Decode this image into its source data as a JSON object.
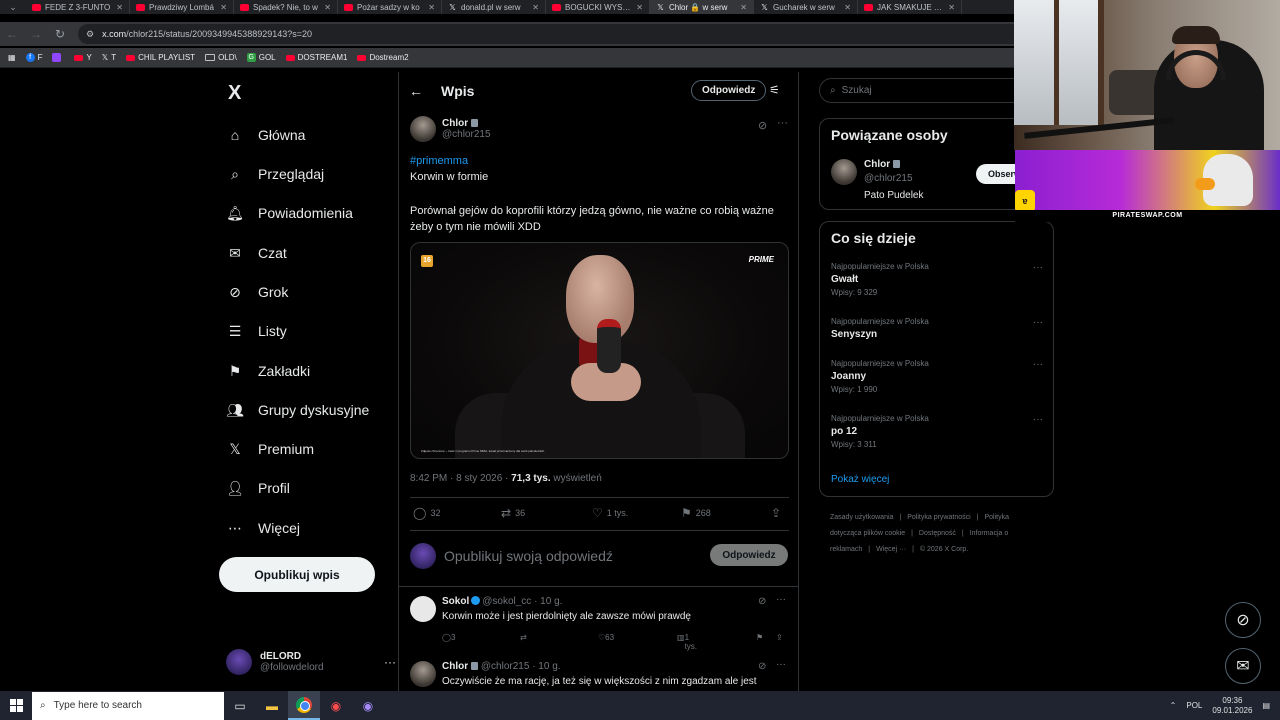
{
  "browser": {
    "tabs": [
      {
        "title": "FEDE Z 3-FUNTO",
        "type": "yt"
      },
      {
        "title": "Prawdziwy Lombá",
        "type": "yt"
      },
      {
        "title": "Spadek? Nie, to w",
        "type": "yt"
      },
      {
        "title": "Pożar sadzy w ko",
        "type": "yt"
      },
      {
        "title": "donald.pl w serw",
        "type": "x"
      },
      {
        "title": "BOGUCKI WYSZE",
        "type": "yt"
      },
      {
        "title": "Chlor 🔒 w serw",
        "type": "x",
        "active": true
      },
      {
        "title": "Gucharek w serw",
        "type": "x"
      },
      {
        "title": "JAK SMAKUJE PIZ",
        "type": "yt"
      }
    ],
    "url_domain": "x.com",
    "url_path": "/chlor215/status/2009349945388929143?s=20",
    "bookmarks": [
      {
        "label": "F",
        "type": "fb"
      },
      {
        "label": "",
        "type": "tw"
      },
      {
        "label": "Y",
        "type": "yt"
      },
      {
        "label": "T",
        "type": "x"
      },
      {
        "label": "CHIL PLAYLIST",
        "type": "yt"
      },
      {
        "label": "OLD\\",
        "type": "folder"
      },
      {
        "label": "GOL",
        "type": "g"
      },
      {
        "label": "DOSTREAM1",
        "type": "yt"
      },
      {
        "label": "Dostream2",
        "type": "yt"
      }
    ]
  },
  "nav": {
    "logo": "X",
    "items": [
      {
        "label": "Główna",
        "icon": "home-icon"
      },
      {
        "label": "Przeglądaj",
        "icon": "search-icon"
      },
      {
        "label": "Powiadomienia",
        "icon": "bell-icon"
      },
      {
        "label": "Czat",
        "icon": "mail-icon"
      },
      {
        "label": "Grok",
        "icon": "grok-icon"
      },
      {
        "label": "Listy",
        "icon": "list-icon"
      },
      {
        "label": "Zakładki",
        "icon": "bookmark-icon"
      },
      {
        "label": "Grupy dyskusyjne",
        "icon": "people-icon"
      },
      {
        "label": "Premium",
        "icon": "x-icon"
      },
      {
        "label": "Profil",
        "icon": "person-icon"
      },
      {
        "label": "Więcej",
        "icon": "more-circle-icon"
      }
    ],
    "post_button": "Opublikuj wpis",
    "me": {
      "name": "dELORD",
      "handle": "@followdelord"
    }
  },
  "post": {
    "header_title": "Wpis",
    "header_replies": "Odpowiedz",
    "author_name": "Chlor",
    "author_handle": "@chlor215",
    "hashtag": "#primemma",
    "line1": "Korwin w formie",
    "body": "Porównał gejów do koprofili którzy jedzą gówno, nie ważne co robią ważne żeby o tym nie mówili XDD",
    "media": {
      "age_badge": "16",
      "brand": "PRIME",
      "caption": "Zdjęcie chronione – treść z programu Prime MMA, kanał przeznaczony dla osób pełnoletnich."
    },
    "time": "8:42 PM · 8 sty 2026 · ",
    "views_count": "71,3 tys.",
    "views_label": " wyświetleń",
    "stats": {
      "replies": "32",
      "reposts": "36",
      "likes": "1 tys.",
      "bookmarks": "268"
    },
    "compose_placeholder": "Opublikuj swoją odpowiedź",
    "compose_button": "Odpowiedz"
  },
  "replies": [
    {
      "name": "Sokol",
      "verified": true,
      "handle": "@sokol_cc",
      "time": "· 10 g.",
      "text": "Korwin może i jest pierdolnięty ale zawsze mówi prawdę",
      "replies": "3",
      "likes": "63",
      "views": "1 tys."
    },
    {
      "name": "Chlor",
      "verified": false,
      "handle": "@chlor215",
      "time": "· 10 g.",
      "text": "Oczywiście że ma rację, ja też się w większości z nim zgadzam ale jest"
    }
  ],
  "right": {
    "search_placeholder": "Szukaj",
    "related_title": "Powiązane osoby",
    "related": {
      "name": "Chlor",
      "handle": "@chlor215",
      "desc": "Pato Pudelek",
      "button": "Obserwuj"
    },
    "trends_title": "Co się dzieje",
    "trends": [
      {
        "context": "Najpopularniejsze w Polska",
        "name": "Gwałt",
        "count": "Wpisy: 9 329"
      },
      {
        "context": "Najpopularniejsze w Polska",
        "name": "Senyszyn",
        "count": ""
      },
      {
        "context": "Najpopularniejsze w Polska",
        "name": "Joanny",
        "count": "Wpisy: 1 990"
      },
      {
        "context": "Najpopularniejsze w Polska",
        "name": "po 12",
        "count": "Wpisy: 3 311"
      }
    ],
    "show_more": "Pokaż więcej",
    "footer": [
      "Zasady użytkowania",
      "Polityka prywatności",
      "Polityka dotycząca plików cookie",
      "Dostępność",
      "Informacja o reklamach",
      "Więcej ···",
      "© 2026 X Corp."
    ]
  },
  "overlay": {
    "sponsor": "PIRATESWAP.COM"
  },
  "taskbar": {
    "search_placeholder": "Type here to search",
    "lang": "POL",
    "time": "09:36",
    "date": "09.01.2026"
  }
}
